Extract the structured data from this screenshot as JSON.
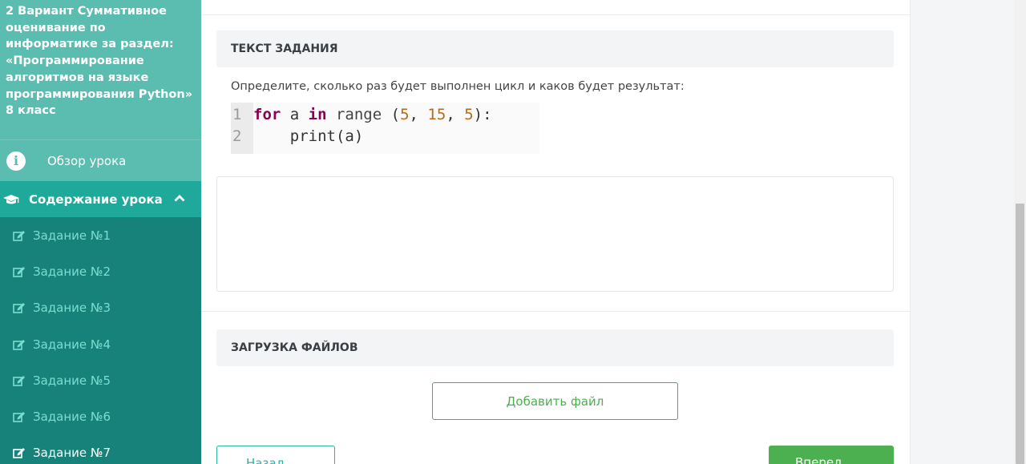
{
  "sidebar": {
    "title": "2 Вариант Суммативное оценивание по информатике за раздел: «Программирование алгоритмов на языке программирования Python» 8 класс",
    "overview": "Обзор урока",
    "content": "Содержание урока",
    "items": [
      {
        "label": "Задание №1"
      },
      {
        "label": "Задание №2"
      },
      {
        "label": "Задание №3"
      },
      {
        "label": "Задание №4"
      },
      {
        "label": "Задание №5"
      },
      {
        "label": "Задание №6"
      },
      {
        "label": "Задание №7"
      }
    ],
    "active_item": 7
  },
  "task": {
    "heading": "ТЕКСТ ЗАДАНИЯ",
    "text": "Определите, сколько раз будет выполнен цикл и каков будет результат:",
    "code": {
      "line1_num": "1",
      "line1_kw1": "for",
      "line1_var": " a ",
      "line1_kw2": "in",
      "line1_fn": " range ",
      "line1_p1": "(",
      "line1_n1": "5",
      "line1_c1": ", ",
      "line1_n2": "15",
      "line1_c2": ", ",
      "line1_n3": "5",
      "line1_p2": "):",
      "line2_num": "2",
      "line2_code": "    print(a)"
    }
  },
  "answer": {
    "value": ""
  },
  "upload": {
    "heading": "ЗАГРУЗКА ФАЙЛОВ",
    "add_file": "Добавить файл"
  },
  "nav": {
    "back": "Назад",
    "next": "Вперед"
  },
  "colors": {
    "sidebar_bg": "#178279",
    "sidebar_header": "#5bbcb0",
    "sidebar_active": "#1fa99b",
    "accent_green": "#4caf50"
  }
}
